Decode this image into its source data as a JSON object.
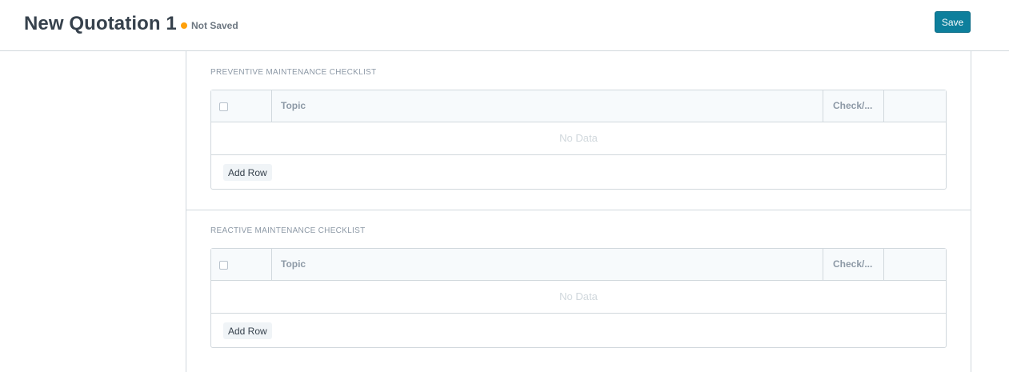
{
  "header": {
    "title": "New Quotation 1",
    "status": "Not Saved",
    "status_color": "#ffa00a",
    "save_label": "Save",
    "save_color": "#0d7f9c"
  },
  "sections": [
    {
      "label": "PREVENTIVE MAINTENANCE CHECKLIST",
      "columns": [
        "Topic",
        "Check/..."
      ],
      "empty_text": "No Data",
      "add_row_label": "Add Row"
    },
    {
      "label": "REACTIVE MAINTENANCE CHECKLIST",
      "columns": [
        "Topic",
        "Check/..."
      ],
      "empty_text": "No Data",
      "add_row_label": "Add Row"
    }
  ]
}
